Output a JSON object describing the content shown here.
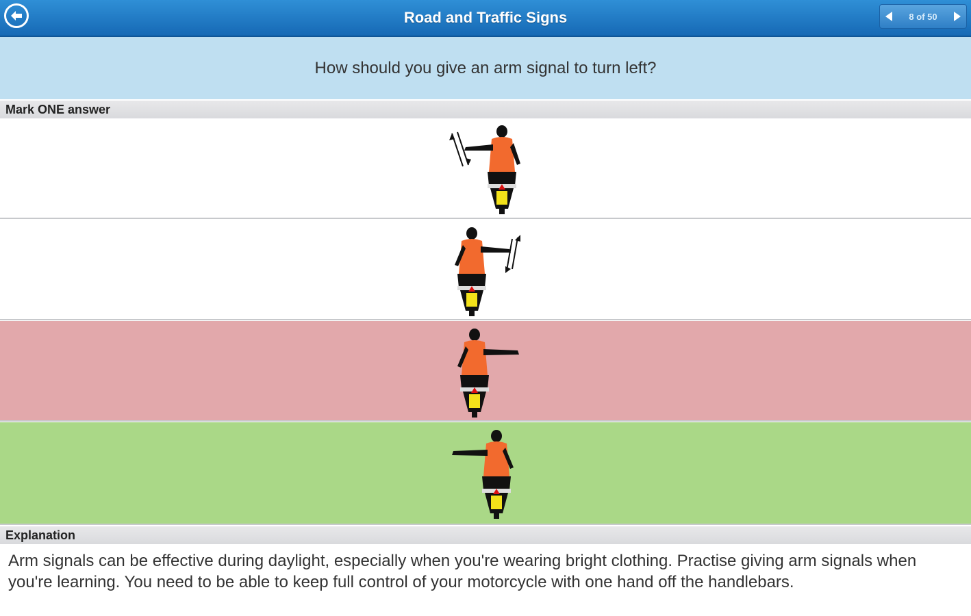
{
  "header": {
    "title": "Road and Traffic Signs",
    "counter": "8 of 50"
  },
  "question": "How should you give an arm signal to turn left?",
  "answers_label": "Mark ONE answer",
  "answers": [
    {
      "state": "neutral",
      "background": "#f7f8fa"
    },
    {
      "state": "neutral",
      "background": "#f7f8fa"
    },
    {
      "state": "incorrect",
      "background": "#e2a8ab"
    },
    {
      "state": "correct",
      "background": "#aad887"
    }
  ],
  "explanation_label": "Explanation",
  "explanation": "Arm signals can be effective during daylight, especially when you're wearing bright clothing. Practise giving arm signals when you're learning. You need to be able to keep full control of your motorcycle with one hand off the handlebars.",
  "colors": {
    "header_blue": "#1f7cc8",
    "question_bg": "#bfdff1",
    "rider_vest": "#f26a2e",
    "plate_yellow": "#f3e21a"
  },
  "icons": {
    "back": "back-arrow-icon",
    "prev": "chevron-left-icon",
    "next": "chevron-right-icon"
  }
}
